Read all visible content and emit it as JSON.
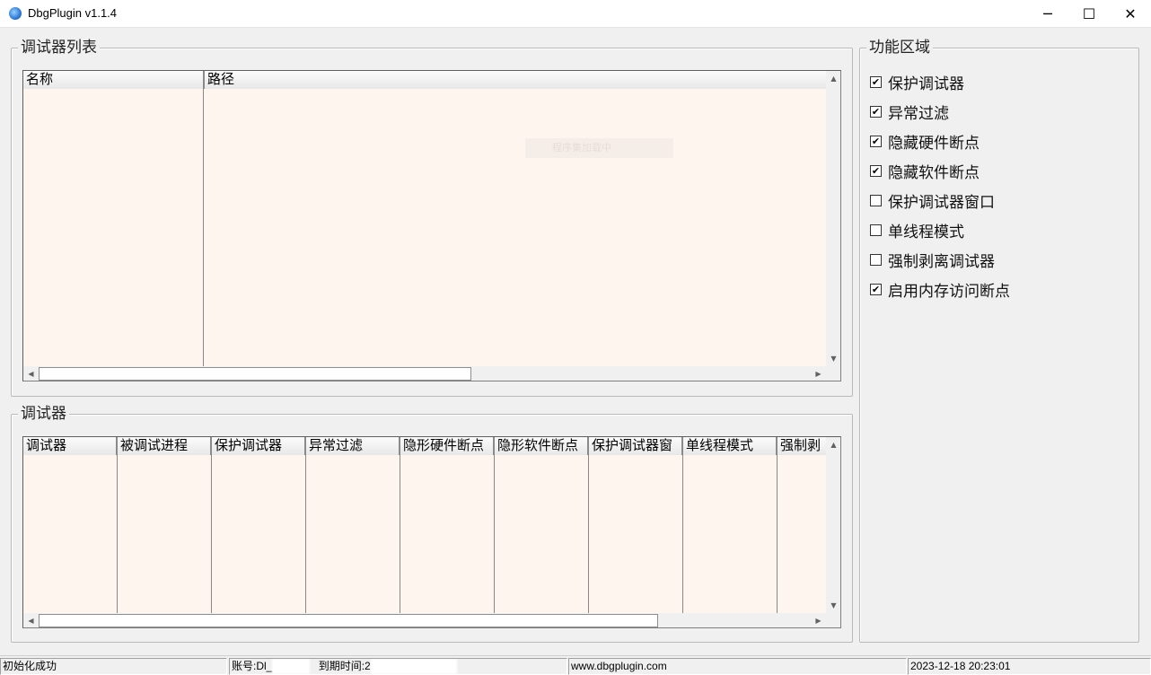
{
  "window": {
    "title": "DbgPlugin v1.1.4",
    "controls": {
      "minimize": "─",
      "maximize": "☐",
      "close": "✕"
    }
  },
  "debugger_list_group": {
    "title": "调试器列表",
    "columns": [
      "名称",
      "路径"
    ],
    "watermark": "程序集加载中"
  },
  "debugger_group": {
    "title": "调试器",
    "columns": [
      "调试器",
      "被调试进程",
      "保护调试器",
      "异常过滤",
      "隐形硬件断点",
      "隐形软件断点",
      "保护调试器窗",
      "单线程模式",
      "强制剥"
    ]
  },
  "function_group": {
    "title": "功能区域",
    "options": [
      {
        "label": "保护调试器",
        "checked": true
      },
      {
        "label": "异常过滤",
        "checked": true
      },
      {
        "label": "隐藏硬件断点",
        "checked": true
      },
      {
        "label": "隐藏软件断点",
        "checked": true
      },
      {
        "label": "保护调试器窗口",
        "checked": false
      },
      {
        "label": "单线程模式",
        "checked": false
      },
      {
        "label": "强制剥离调试器",
        "checked": false
      },
      {
        "label": "启用内存访问断点",
        "checked": true
      }
    ]
  },
  "statusbar": {
    "status": "初始化成功",
    "account_label": "账号:",
    "account_value": "Dl_",
    "expire_label": "到期时间:",
    "expire_value": "2",
    "website": "www.dbgplugin.com",
    "datetime": "2023-12-18 20:23:01"
  },
  "colors": {
    "list_background": "#fdf5ee",
    "window_background": "#f0f0f0"
  }
}
